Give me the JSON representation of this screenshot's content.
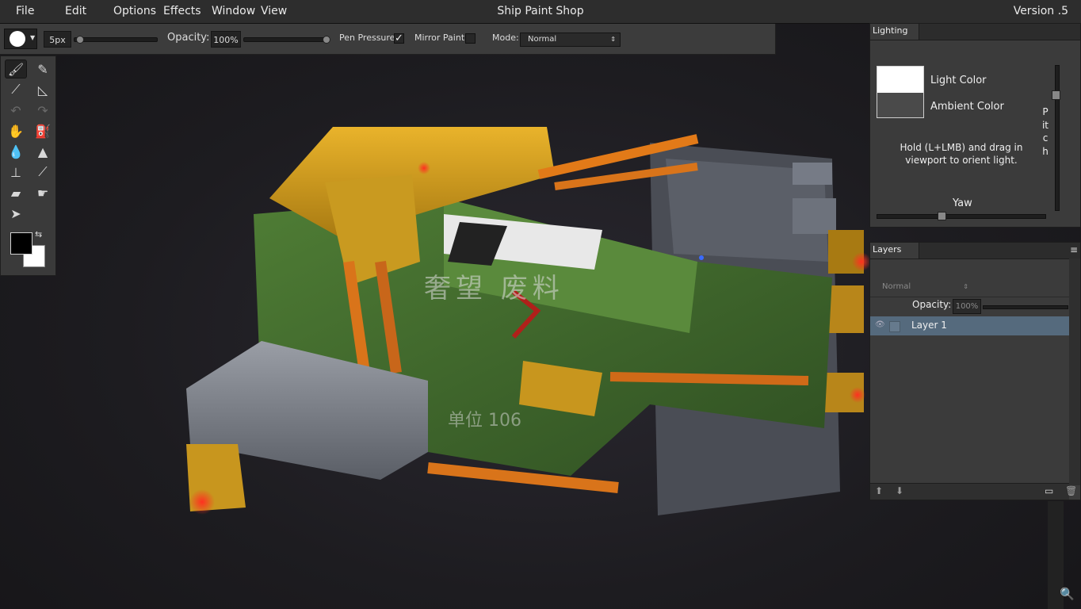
{
  "app": {
    "title": "Ship Paint Shop",
    "version": "Version .5"
  },
  "menu": {
    "file": "File",
    "edit": "Edit",
    "options": "Options",
    "effects": "Effects",
    "window": "Window",
    "view": "View"
  },
  "options_bar": {
    "brush_size": "5px",
    "opacity_label": "Opacity:",
    "opacity_value": "100%",
    "pen_pressure_label": "Pen Pressure",
    "pen_pressure_checked": "✓",
    "mirror_paint_label": "Mirror Paint",
    "mode_label": "Mode:",
    "mode_value": "Normal",
    "size_slider_level": 0.04,
    "opacity_slider_level": 1.0
  },
  "toolbox": {
    "tools": [
      "brush-icon",
      "pencil-icon",
      "smudge-icon",
      "airbrush-icon",
      "undo-icon",
      "redo-icon",
      "hand-icon",
      "fill-bucket-icon",
      "blur-drop-icon",
      "sharpen-icon",
      "stamp-icon",
      "eyedropper-icon",
      "eraser-icon",
      "smudge-finger-icon",
      "pointer-icon"
    ],
    "foreground_color": "#000000",
    "background_color": "#ffffff"
  },
  "lighting_panel": {
    "tab": "Lighting",
    "light_color_label": "Light Color",
    "ambient_color_label": "Ambient Color",
    "light_color": "#ffffff",
    "ambient_color": "#4a4a4a",
    "hint": "Hold (L+LMB) and drag in viewport to orient light.",
    "pitch_label": "Pitch",
    "yaw_label": "Yaw"
  },
  "layers_panel": {
    "tab": "Layers",
    "blend_mode": "Normal",
    "opacity_label": "Opacity:",
    "opacity_value": "100%",
    "layers": [
      {
        "name": "Layer 1",
        "selected": true
      }
    ]
  },
  "viewport": {
    "hull_markings": [
      "奢望 废料",
      "单位 106"
    ]
  }
}
